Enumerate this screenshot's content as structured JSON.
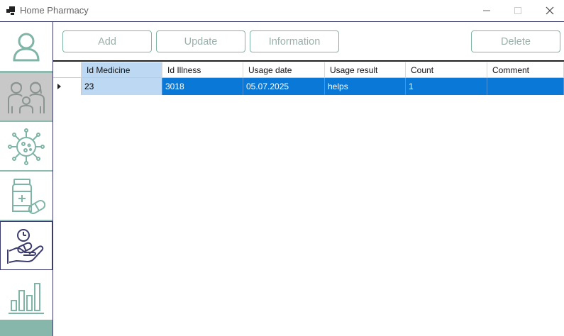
{
  "window": {
    "title": "Home Pharmacy",
    "minimize_glyph": "—",
    "maximize_glyph": "☐",
    "close_glyph": "✕"
  },
  "sidebar": {
    "items": [
      {
        "id": "user",
        "icon": "user-icon",
        "active": false
      },
      {
        "id": "family",
        "icon": "family-icon",
        "active": true
      },
      {
        "id": "illness",
        "icon": "virus-icon",
        "active": false
      },
      {
        "id": "medicine",
        "icon": "medicine-bottle-icon",
        "active": false
      },
      {
        "id": "usage",
        "icon": "hand-pill-clock-icon",
        "active": false
      },
      {
        "id": "statistics",
        "icon": "bar-chart-icon",
        "active": false
      }
    ]
  },
  "toolbar": {
    "add_label": "Add",
    "update_label": "Update",
    "information_label": "Information",
    "delete_label": "Delete"
  },
  "grid": {
    "columns": [
      "Id Medicine",
      "Id Illness",
      "Usage date",
      "Usage result",
      "Count",
      "Comment"
    ],
    "rows": [
      [
        "23",
        "3018",
        "05.07.2025",
        "helps",
        "1",
        ""
      ]
    ]
  },
  "colors": {
    "accent_teal": "#86b7aa",
    "frame_dark": "#3b3b6e",
    "selection_blue": "#0a78d7",
    "header_selected": "#bcd8f2"
  }
}
